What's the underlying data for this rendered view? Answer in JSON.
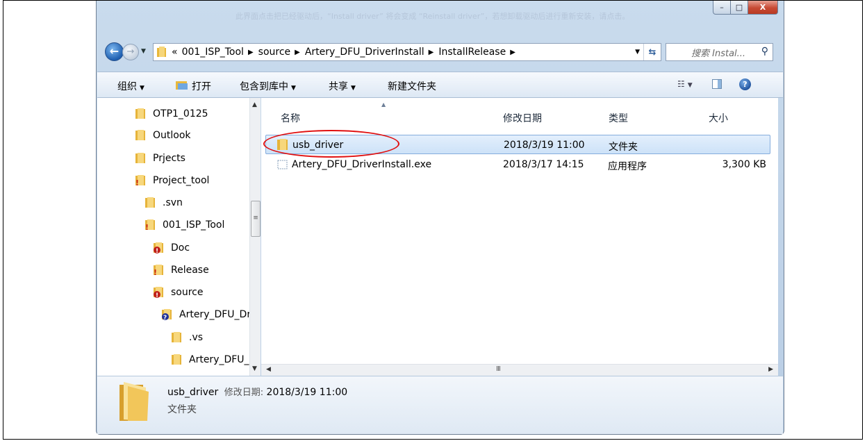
{
  "window": {
    "faded_background_text": "此界面点击把已经驱动后，“Install driver” 将会变成 “Reinstall driver”，若想卸载驱动后进行重新安装，请点击。"
  },
  "window_controls": {
    "minimize": "–",
    "maximize": "□",
    "close": "X"
  },
  "address_bar": {
    "overflow": "«",
    "crumbs": [
      "001_ISP_Tool",
      "source",
      "Artery_DFU_DriverInstall",
      "InstallRelease"
    ]
  },
  "search": {
    "placeholder": "搜索 Instal..."
  },
  "toolbar": {
    "organize": "组织",
    "open": "打开",
    "include_in_library": "包含到库中",
    "share": "共享",
    "new_folder": "新建文件夹"
  },
  "nav_tree": [
    {
      "label": "OTP1_0125",
      "icon": "folder-icon"
    },
    {
      "label": "Outlook",
      "icon": "folder-icon"
    },
    {
      "label": "Prjects",
      "icon": "folder-icon"
    },
    {
      "label": "Project_tool",
      "icon": "svn-modified-folder-icon"
    },
    {
      "label": ".svn",
      "icon": "folder-icon"
    },
    {
      "label": "001_ISP_Tool",
      "icon": "svn-modified-folder-icon"
    },
    {
      "label": "Doc",
      "icon": "svn-conflict-folder-icon"
    },
    {
      "label": "Release",
      "icon": "svn-modified-folder-icon"
    },
    {
      "label": "source",
      "icon": "svn-conflict-folder-icon"
    },
    {
      "label": "Artery_DFU_Dr",
      "icon": "svn-unversioned-folder-icon"
    },
    {
      "label": ".vs",
      "icon": "folder-icon"
    },
    {
      "label": "Artery_DFU_",
      "icon": "folder-icon"
    }
  ],
  "columns": {
    "name": "名称",
    "date": "修改日期",
    "type": "类型",
    "size": "大小"
  },
  "files": [
    {
      "name": "usb_driver",
      "date": "2018/3/19 11:00",
      "type": "文件夹",
      "size": "",
      "icon": "folder-icon",
      "selected": true
    },
    {
      "name": "Artery_DFU_DriverInstall.exe",
      "date": "2018/3/17 14:15",
      "type": "应用程序",
      "size": "3,300 KB",
      "icon": "exe-icon",
      "selected": false
    }
  ],
  "details": {
    "name": "usb_driver",
    "date_label": "修改日期:",
    "date": "2018/3/19 11:00",
    "type": "文件夹"
  },
  "colors": {
    "selection": "#cde2f8",
    "highlight_ellipse": "#e01010",
    "folder": "#f2c24a"
  }
}
